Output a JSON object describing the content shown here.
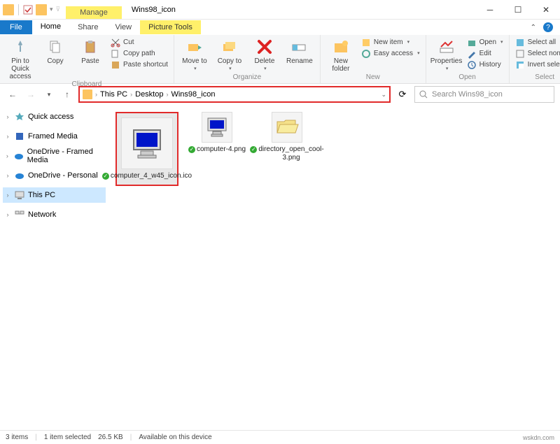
{
  "window": {
    "title": "Wins98_icon",
    "context_tab": "Manage",
    "context_group": "Picture Tools"
  },
  "tabs": {
    "file": "File",
    "home": "Home",
    "share": "Share",
    "view": "View"
  },
  "ribbon": {
    "clipboard": {
      "label": "Clipboard",
      "pin": "Pin to Quick access",
      "copy": "Copy",
      "paste": "Paste",
      "cut": "Cut",
      "copy_path": "Copy path",
      "paste_shortcut": "Paste shortcut"
    },
    "organize": {
      "label": "Organize",
      "move_to": "Move to",
      "copy_to": "Copy to",
      "delete": "Delete",
      "rename": "Rename"
    },
    "new": {
      "label": "New",
      "new_folder": "New folder",
      "new_item": "New item",
      "easy_access": "Easy access"
    },
    "open": {
      "label": "Open",
      "properties": "Properties",
      "open": "Open",
      "edit": "Edit",
      "history": "History"
    },
    "select": {
      "label": "Select",
      "select_all": "Select all",
      "select_none": "Select none",
      "invert": "Invert selection"
    }
  },
  "breadcrumb": [
    "This PC",
    "Desktop",
    "Wins98_icon"
  ],
  "search_placeholder": "Search Wins98_icon",
  "nav": {
    "quick_access": "Quick access",
    "framed_media": "Framed Media",
    "onedrive_fm": "OneDrive - Framed Media",
    "onedrive_personal": "OneDrive - Personal",
    "this_pc": "This PC",
    "network": "Network"
  },
  "files": [
    {
      "name": "computer_4_w45_icon.ico",
      "selected": true,
      "type": "monitor"
    },
    {
      "name": "computer-4.png",
      "selected": false,
      "type": "monitor"
    },
    {
      "name": "directory_open_cool-3.png",
      "selected": false,
      "type": "folder"
    }
  ],
  "status": {
    "count": "3 items",
    "selected": "1 item selected",
    "size": "26.5 KB",
    "availability": "Available on this device"
  },
  "watermark": "wskdn.com"
}
